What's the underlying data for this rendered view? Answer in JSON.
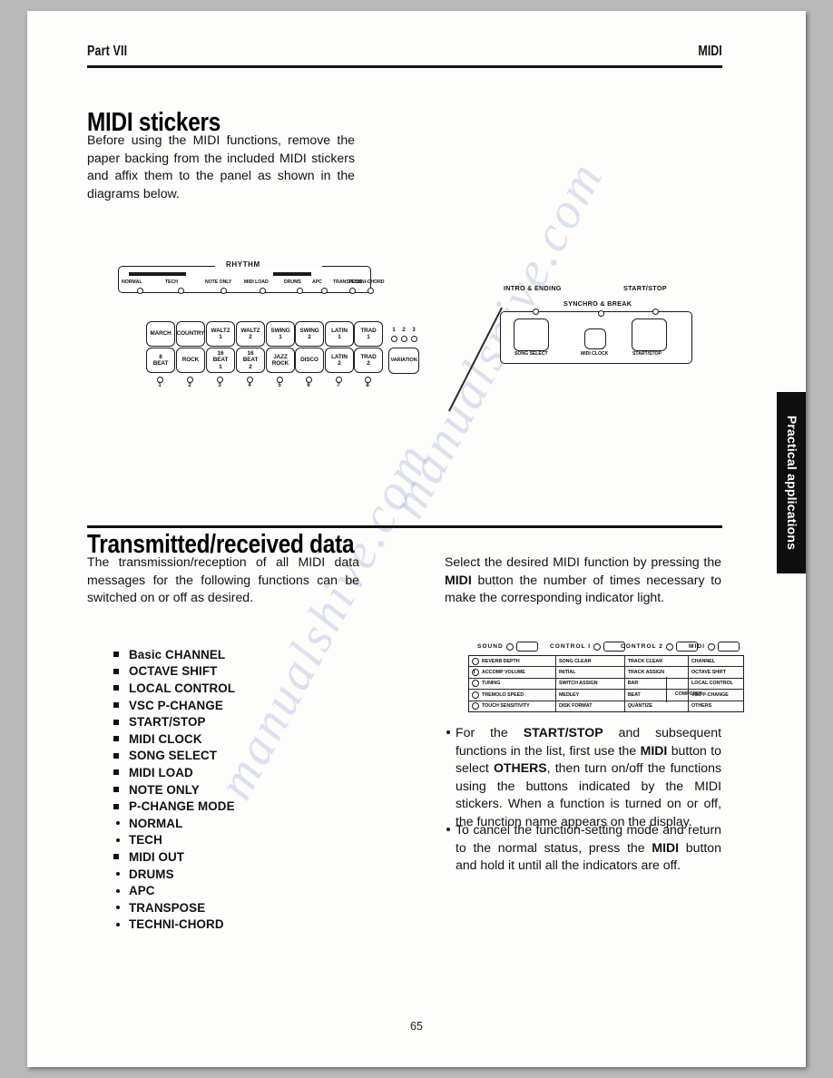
{
  "header": {
    "part": "Part VII",
    "topic": "MIDI"
  },
  "section1": {
    "title": "MIDI stickers",
    "paragraph": "Before using the MIDI functions, remove the paper backing from the included MIDI stickers and affix them to the panel as shown in the diagrams below."
  },
  "rhythm_panel": {
    "group_label": "RHYTHM",
    "sticker_labels": [
      "NORMAL",
      "TECH",
      "NOTE ONLY",
      "MIDI LOAD",
      "DRUMS",
      "APC",
      "TRANSPOSE",
      "TECHNI-CHORD"
    ],
    "row1": [
      "MARCH",
      "COUNTRY",
      "WALTZ 1",
      "WALTZ 2",
      "SWING 1",
      "SWING 2",
      "LATIN 1",
      "TRAD 1"
    ],
    "row2": [
      "8 BEAT",
      "ROCK",
      "16 BEAT 1",
      "16 BEAT 2",
      "JAZZ ROCK",
      "DISCO",
      "LATIN 2",
      "TRAD 2"
    ],
    "variation_label": "VARIATION",
    "variation_numbers": [
      "1",
      "2",
      "3"
    ],
    "led_numbers": [
      "1",
      "2",
      "3",
      "4",
      "5",
      "6",
      "7",
      "8"
    ]
  },
  "transport_panel": {
    "top_labels": [
      "INTRO & ENDING",
      "SYNCHRO & BREAK",
      "START/STOP"
    ],
    "button_labels": [
      "SONG SELECT",
      "MIDI CLOCK",
      "START/STOP"
    ]
  },
  "section2": {
    "title": "Transmitted/received data",
    "left_paragraph": "The transmission/reception of all MIDI data messages for the following functions can be switched on or off as desired.",
    "functions": [
      {
        "label": "Basic CHANNEL",
        "marker": "square"
      },
      {
        "label": "OCTAVE SHIFT",
        "marker": "square"
      },
      {
        "label": "LOCAL CONTROL",
        "marker": "square"
      },
      {
        "label": "VSC P-CHANGE",
        "marker": "square"
      },
      {
        "label": "START/STOP",
        "marker": "square"
      },
      {
        "label": "MIDI CLOCK",
        "marker": "square"
      },
      {
        "label": "SONG SELECT",
        "marker": "square"
      },
      {
        "label": "MIDI LOAD",
        "marker": "square"
      },
      {
        "label": "NOTE ONLY",
        "marker": "square"
      },
      {
        "label": "P-CHANGE MODE",
        "marker": "square"
      },
      {
        "label": "NORMAL",
        "marker": "dot"
      },
      {
        "label": "TECH",
        "marker": "dot"
      },
      {
        "label": "MIDI OUT",
        "marker": "square"
      },
      {
        "label": "DRUMS",
        "marker": "dot"
      },
      {
        "label": "APC",
        "marker": "dot"
      },
      {
        "label": "TRANSPOSE",
        "marker": "dot"
      },
      {
        "label": "TECHNI-CHORD",
        "marker": "dot"
      }
    ],
    "right_intro": "Select the desired MIDI function by pressing the MIDI button the number of times necessary to make the corresponding indicator light.",
    "notes": [
      "For the START/STOP and subsequent functions in the list, first use the MIDI button to select OTHERS, then turn on/off the functions using the buttons indicated by the MIDI stickers. When a function is turned on or off, the function name appears on the display.",
      "To cancel the function-setting mode and return to the normal status, press the MIDI button and hold it until all the indicators are off."
    ]
  },
  "sticker_table": {
    "headers": [
      "SOUND",
      "CONTROL I",
      "CONTROL 2",
      "MIDI"
    ],
    "columns": {
      "sound": [
        "REVERB DEPTH",
        "ACCOMP VOLUME",
        "TUNING",
        "TREMOLO SPEED",
        "TOUCH SENSITIVITY"
      ],
      "control1": [
        "SONG CLEAR",
        "INITIAL",
        "SWITCH ASSIGN",
        "MEDLEY",
        "DISK FORMAT"
      ],
      "control2": [
        "TRACK CLEAR",
        "TRACK ASSIGN",
        "BAR",
        "BEAT",
        "QUANTIZE"
      ],
      "midi": [
        "CHANNEL",
        "OCTAVE SHIFT",
        "LOCAL CONTROL",
        "VSC P-CHANGE",
        "OTHERS"
      ]
    },
    "composer_bracket_label": "COMPOSER"
  },
  "side_tab": {
    "label": "Practical applications"
  },
  "page_number": "65",
  "watermark": {
    "text_a": "manualsnive.com",
    "text_b": "manualshive.com"
  }
}
